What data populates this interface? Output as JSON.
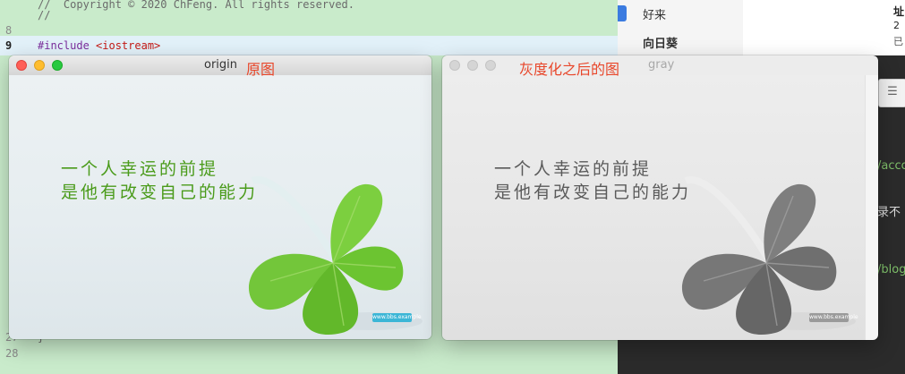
{
  "editor": {
    "lines": [
      {
        "num": "",
        "text": "//  Copyright © 2020 ChFeng. All rights reserved."
      },
      {
        "num": "",
        "text": "//"
      },
      {
        "num": "8",
        "text": ""
      },
      {
        "num": "9",
        "directive": "#include ",
        "header": "<iostream>"
      },
      {
        "num": "27",
        "text": "}"
      },
      {
        "num": "28",
        "text": ""
      }
    ]
  },
  "chat": {
    "items": [
      {
        "name": "好来"
      },
      {
        "name": "向日葵"
      }
    ]
  },
  "doc": {
    "t1": "址",
    "t2": "2",
    "t3": "已"
  },
  "blog": {
    "toolbar_icon": "list-icon",
    "texts": [
      "/acco",
      "录不",
      "/blog"
    ]
  },
  "windows": {
    "origin": {
      "title": "origin",
      "tagline_line1": "一个人幸运的前提",
      "tagline_line2": "是他有改变自己的能力",
      "watermark": "www.bbs.example",
      "colors": {
        "text": "#4a9b1a",
        "leaf": "#6cc431",
        "watermark": "#3cb6d6"
      }
    },
    "gray": {
      "title": "gray",
      "tagline_line1": "一个人幸运的前提",
      "tagline_line2": "是他有改变自己的能力",
      "watermark": "www.bbs.example",
      "colors": {
        "text": "#5a5a5a",
        "leaf": "#6f6f6f",
        "watermark": "#9a9a9a"
      }
    }
  },
  "annotations": {
    "origin_label": "原图",
    "gray_label": "灰度化之后的图"
  }
}
